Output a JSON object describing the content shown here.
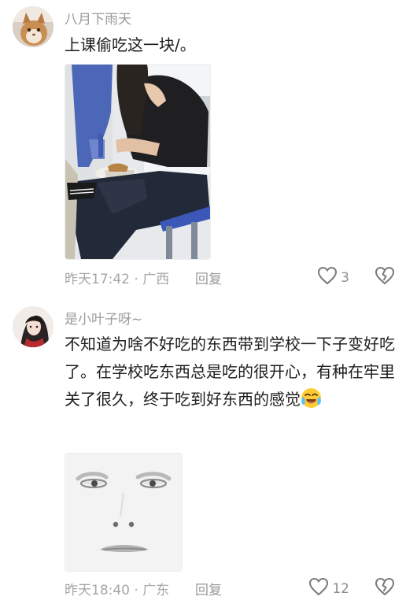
{
  "comments": [
    {
      "username": "八月下雨天",
      "text": "上课偷吃这一块/。",
      "time_location": "昨天17:42 · 广西",
      "reply_label": "回复",
      "like_count": "3"
    },
    {
      "username": "是小叶子呀~",
      "text": "不知道为啥不好吃的东西带到学校一下子变好吃了。在学校吃东西总是吃的很开心，有种在牢里关了很久，终于吃到好东西的感觉",
      "time_location": "昨天18:40 · 广东",
      "reply_label": "回复",
      "like_count": "12"
    }
  ],
  "icons": {
    "like": "heart-outline-icon",
    "dislike": "broken-heart-icon",
    "emoji": "crying-laughing-emoji-icon"
  },
  "colors": {
    "username": "#9b9b9b",
    "meta": "#a6a6a6",
    "text": "#1d1d1d"
  }
}
